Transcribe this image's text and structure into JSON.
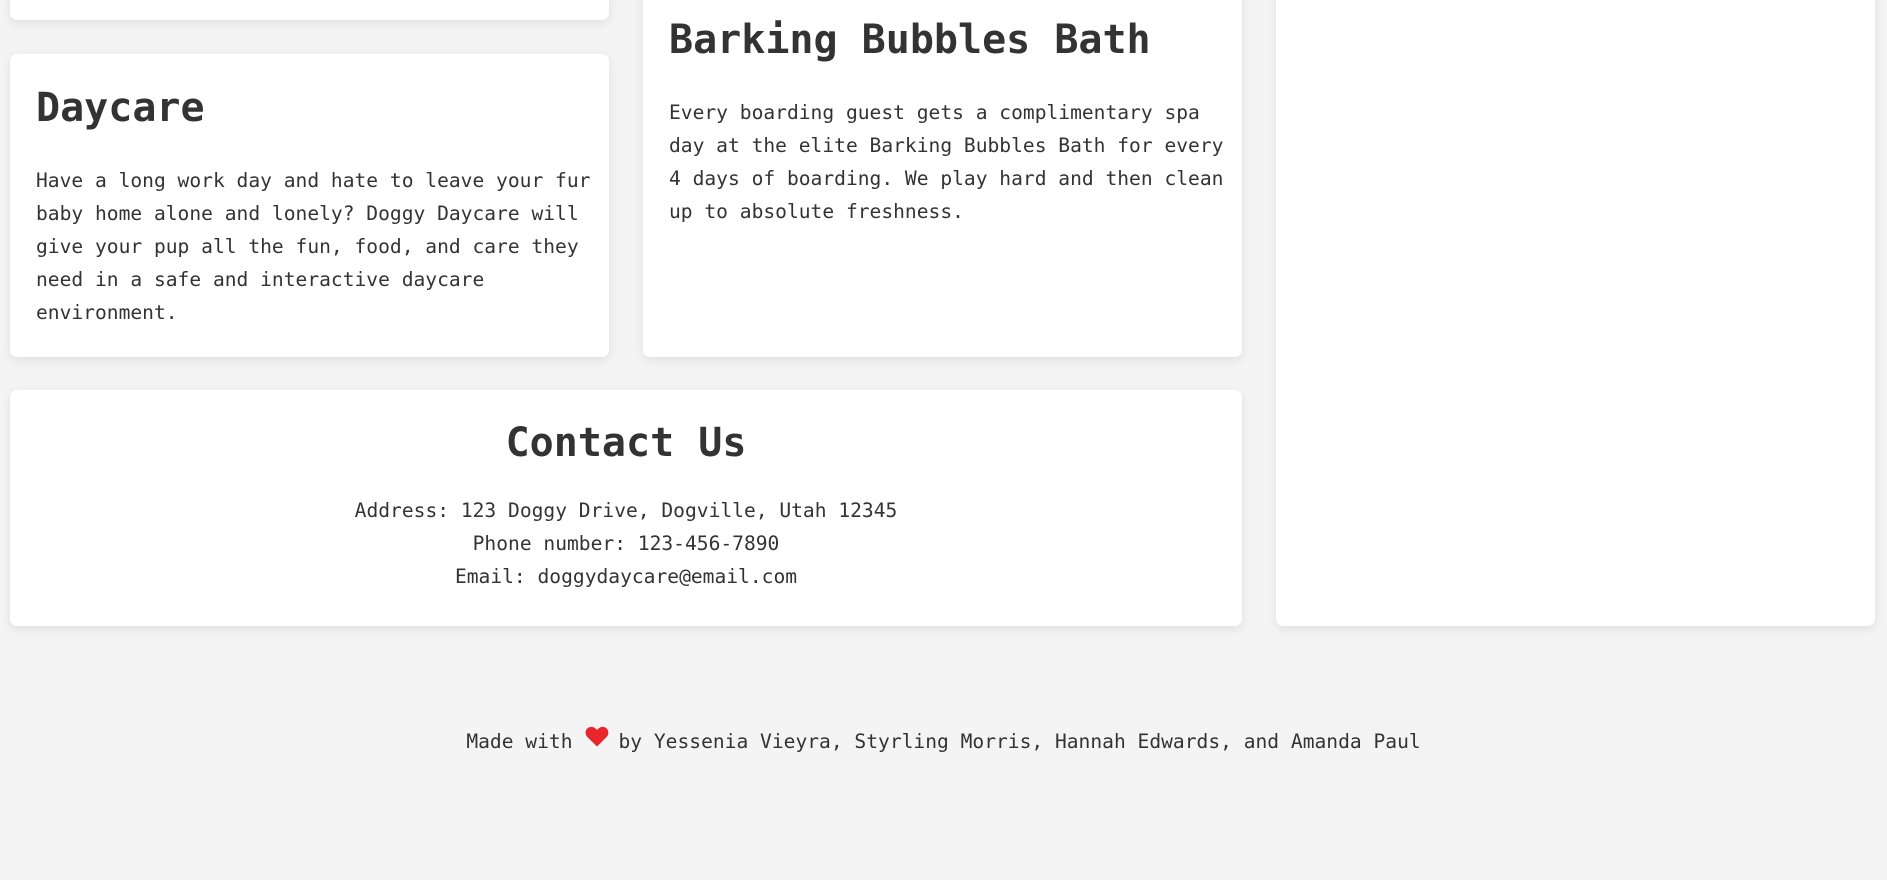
{
  "services": {
    "daycare": {
      "title": "Daycare",
      "description": "Have a long work day and hate to leave your fur baby home alone and lonely? Doggy Daycare will give your pup all the fun, food, and care they need in a safe and interactive daycare environment."
    },
    "bath": {
      "title": "Barking Bubbles Bath",
      "description": "Every boarding guest gets a complimentary spa day at the elite Barking Bubbles Bath for every 4 days of boarding. We play hard and then clean up to absolute freshness."
    }
  },
  "contact": {
    "title": "Contact Us",
    "address": "Address: 123 Doggy Drive, Dogville, Utah 12345",
    "phone": "Phone number: 123-456-7890",
    "email": "Email: doggydaycare@email.com"
  },
  "footer": {
    "prefix": "Made with",
    "heart_icon": "heart-icon",
    "heart_color": "#e8262c",
    "suffix": "by Yessenia Vieyra, Styrling Morris, Hannah Edwards, and Amanda Paul"
  },
  "colors": {
    "background": "#f4f4f4",
    "card": "#ffffff",
    "text": "#333333"
  }
}
